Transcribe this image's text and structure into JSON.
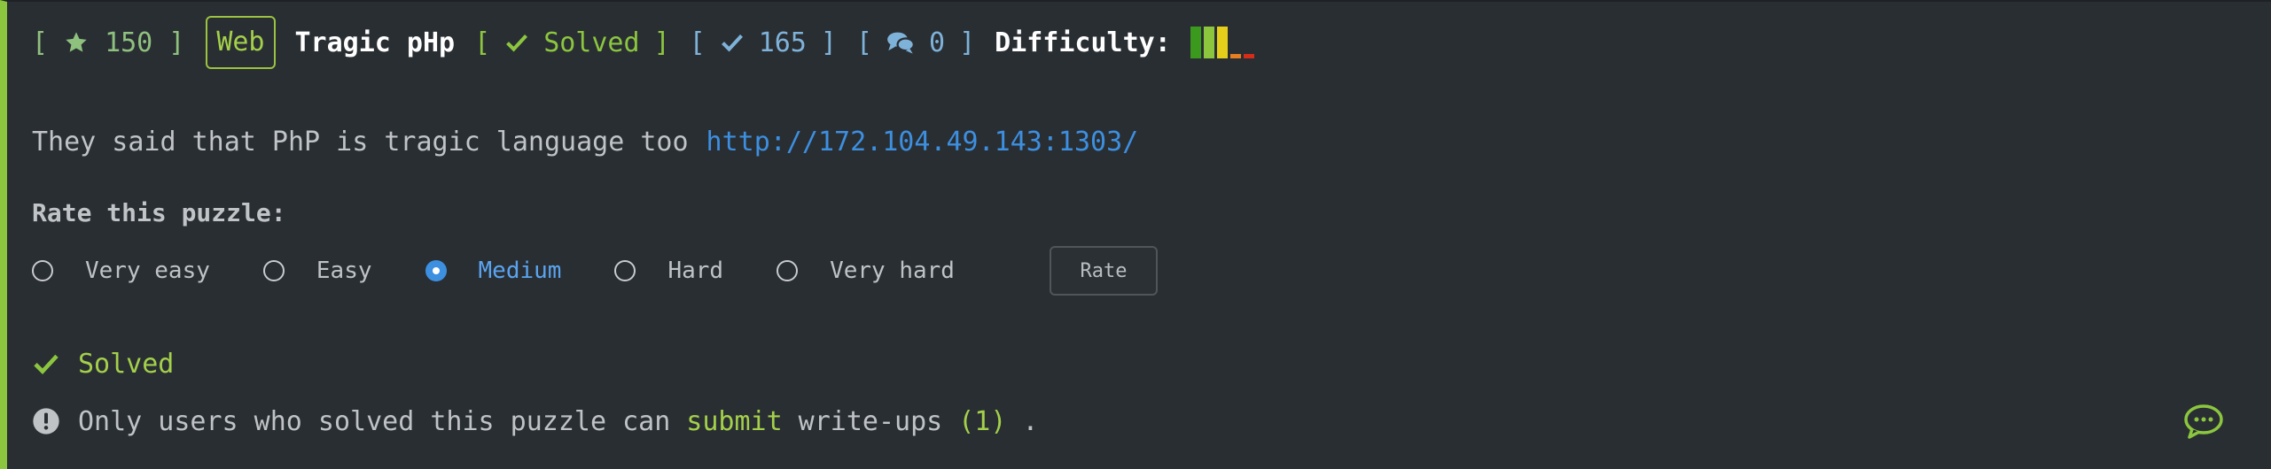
{
  "header": {
    "points": "150",
    "category": "Web",
    "title": "Tragic pHp",
    "status": "Solved",
    "solves": "165",
    "comments": "0",
    "difficulty_label": "Difficulty:",
    "brackets": {
      "open": "[",
      "close": "]"
    },
    "difficulty_bars": [
      {
        "color": "#3b9a1e",
        "level": 1.0
      },
      {
        "color": "#8cc63f",
        "level": 1.0
      },
      {
        "color": "#e6cf1a",
        "level": 1.0
      },
      {
        "color": "#e67e22",
        "level": 0.15
      },
      {
        "color": "#d62c1a",
        "level": 0.15
      }
    ]
  },
  "description": {
    "text": "They said that PhP is tragic language too",
    "link": "http://172.104.49.143:1303/"
  },
  "rating": {
    "label": "Rate this puzzle:",
    "options": [
      "Very easy",
      "Easy",
      "Medium",
      "Hard",
      "Very hard"
    ],
    "selected": "Medium",
    "button_label": "Rate"
  },
  "solved": {
    "label": "Solved"
  },
  "writeups": {
    "prefix": "Only users who solved this puzzle can",
    "link_label": "submit",
    "middle": "write-ups",
    "count": "(1)",
    "suffix": "."
  },
  "colors": {
    "accent_green": "#8cc63f",
    "accent_blue": "#3d8fe0",
    "background": "#292e33"
  },
  "icons": [
    "star-icon",
    "check-icon",
    "comments-icon",
    "exclamation-circle-icon",
    "chat-icon"
  ]
}
